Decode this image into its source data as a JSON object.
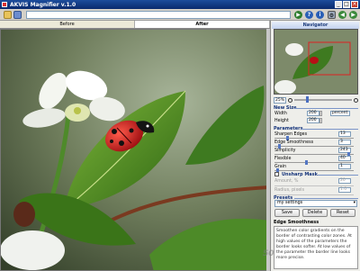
{
  "window": {
    "title": "AKVIS Magnifier v.1.0"
  },
  "tabs": {
    "before": "Before",
    "after": "After"
  },
  "navigator": {
    "title": "Navigator",
    "zoom_value": "25%",
    "zoom_fraction": 0.2
  },
  "new_size": {
    "title": "New Size",
    "width_label": "Width",
    "width_value": "200",
    "height_label": "Height",
    "height_value": "200",
    "unit": "percent"
  },
  "parameters": {
    "title": "Parameters",
    "items": [
      {
        "label": "Sharpen Edges",
        "value": "13",
        "fraction": 0.15
      },
      {
        "label": "Edge Smoothness",
        "value": "3",
        "fraction": 0.05
      },
      {
        "label": "Simplicity",
        "value": "243",
        "fraction": 0.95
      },
      {
        "label": "Flexible",
        "value": "40",
        "fraction": 0.4
      },
      {
        "label": "Grain",
        "value": "1",
        "fraction": 0.02
      }
    ]
  },
  "unsharp_mask": {
    "title": "Unsharp Mask",
    "amount_label": "Amount, %",
    "amount_value": "20",
    "radius_label": "Radius, pixels",
    "radius_value": "1.0"
  },
  "presets": {
    "title": "Presets",
    "selected": "my settings",
    "save": "Save",
    "delete": "Delete",
    "reset": "Reset"
  },
  "help": {
    "title": "Edge Smoothness",
    "text": "Smoothen color gradients on the border of contrasting color zones. At high values of the parameters the border looks softer. At low values of the parameter the border line looks more precise."
  },
  "colors": {
    "accent": "#1b3a7a",
    "titlebar": "#0a2a6e",
    "leaf": "#3f7a1c",
    "ladybug": "#c4121a"
  }
}
